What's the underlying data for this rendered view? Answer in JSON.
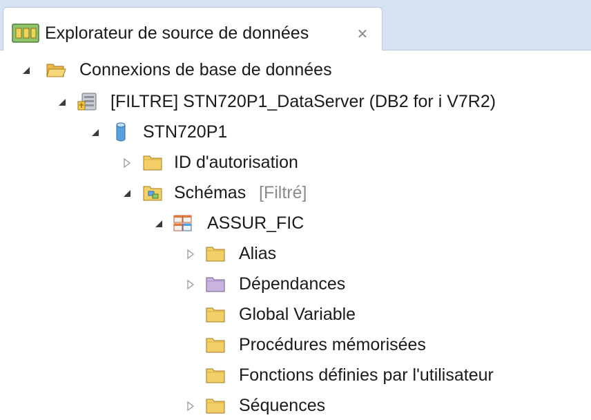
{
  "tab": {
    "title": "Explorateur de source de données",
    "close_icon": "close-icon"
  },
  "tree": {
    "connections": "Connexions de base de données",
    "server": "[FILTRE] STN720P1_DataServer (DB2 for i V7R2)",
    "database": "STN720P1",
    "auth_ids": "ID d'autorisation",
    "schemas": "Schémas",
    "schemas_filter": "[Filtré]",
    "schema_name": "ASSUR_FIC",
    "alias": "Alias",
    "dependencies": "Dépendances",
    "global_variable": "Global Variable",
    "stored_procedures": "Procédures mémorisées",
    "udfs": "Fonctions définies par l'utilisateur",
    "sequences": "Séquences"
  },
  "colors": {
    "tab_background": "#d6e3f3",
    "folder_yellow": "#f3cf6a",
    "folder_purple": "#c9b3df",
    "database_blue": "#5aa0dd"
  }
}
